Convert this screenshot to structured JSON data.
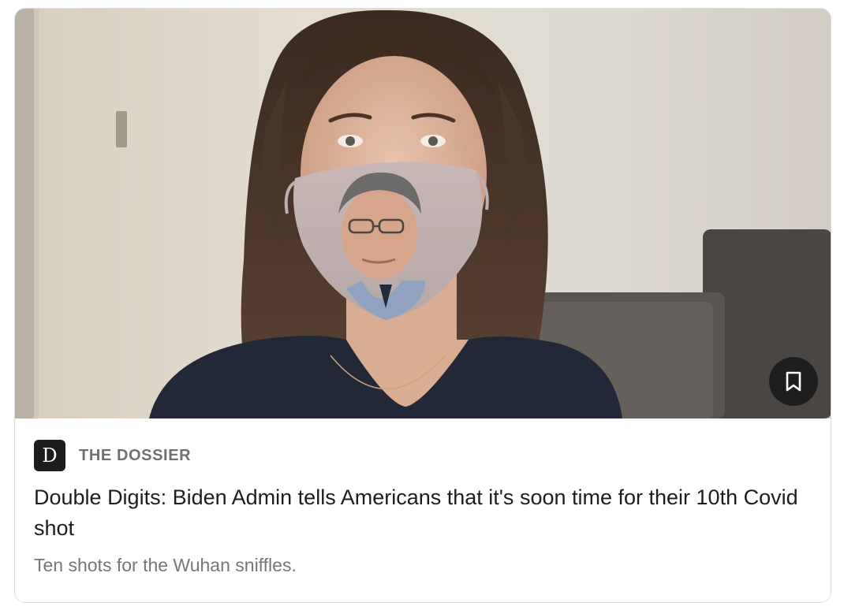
{
  "post": {
    "image_alt": "Woman wearing a face mask printed with a man's portrait",
    "publication": {
      "logo_letter": "D",
      "name": "THE DOSSIER"
    },
    "title": "Double Digits: Biden Admin tells Americans that it's soon time for their 10th Covid shot",
    "subtitle": "Ten shots for the Wuhan sniffles.",
    "bookmark_icon": "bookmark-icon"
  }
}
